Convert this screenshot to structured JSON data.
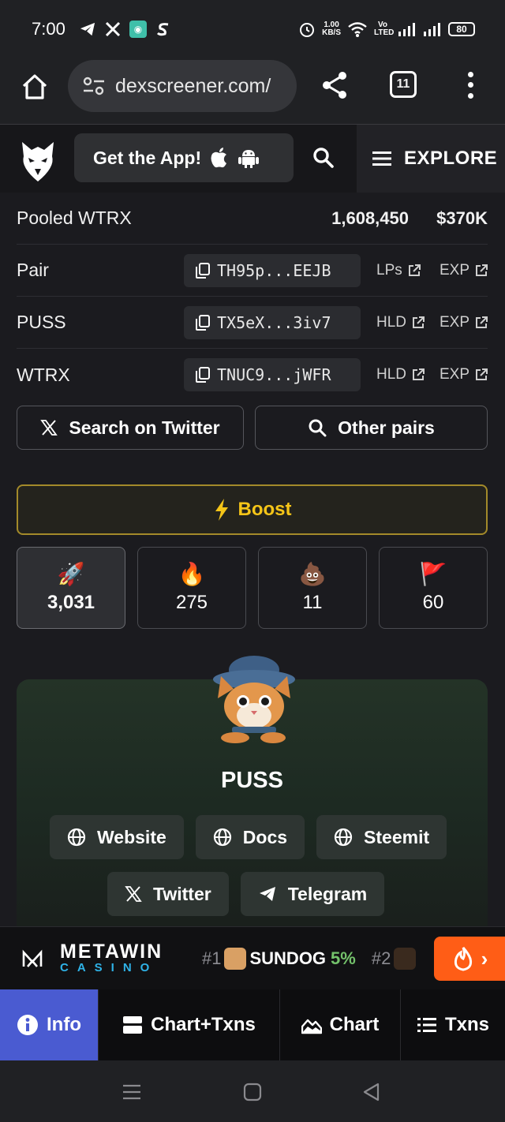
{
  "status_bar": {
    "time": "7:00",
    "net_speed_top": "1.00",
    "net_speed_bottom": "KB/S",
    "volte": "Vo LTED",
    "battery": "80"
  },
  "browser": {
    "url": "dexscreener.com/",
    "tab_count": "11"
  },
  "site_header": {
    "get_app_label": "Get the App!",
    "explore_label": "EXPLORE"
  },
  "pooled": {
    "label": "Pooled WTRX",
    "amount": "1,608,450",
    "usd": "$370K"
  },
  "addresses": [
    {
      "label": "Pair",
      "address": "TH95p...EEJB",
      "link1": "LPs",
      "link2": "EXP"
    },
    {
      "label": "PUSS",
      "address": "TX5eX...3iv7",
      "link1": "HLD",
      "link2": "EXP"
    },
    {
      "label": "WTRX",
      "address": "TNUC9...jWFR",
      "link1": "HLD",
      "link2": "EXP"
    }
  ],
  "actions": {
    "twitter_search": "Search on Twitter",
    "other_pairs": "Other pairs"
  },
  "boost": {
    "label": "Boost",
    "color": "#f5c518"
  },
  "reactions": [
    {
      "emoji": "🚀",
      "count": "3,031",
      "icon": "rocket-icon"
    },
    {
      "emoji": "🔥",
      "count": "275",
      "icon": "fire-icon"
    },
    {
      "emoji": "💩",
      "count": "11",
      "icon": "poop-icon"
    },
    {
      "emoji": "🚩",
      "count": "60",
      "icon": "red-flag-icon"
    }
  ],
  "token": {
    "name": "PUSS",
    "links": [
      "Website",
      "Docs",
      "Steemit",
      "Twitter",
      "Telegram"
    ]
  },
  "ad": {
    "brand_top": "METAWIN",
    "brand_bottom": "CASINO",
    "trend1_rank": "#1",
    "trend1_name": "SUNDOG",
    "trend1_pct": "5%",
    "trend2_rank": "#2"
  },
  "tabs": {
    "info": "Info",
    "chart_txns": "Chart+Txns",
    "chart": "Chart",
    "txns": "Txns",
    "active_color": "#4a5bd1"
  }
}
